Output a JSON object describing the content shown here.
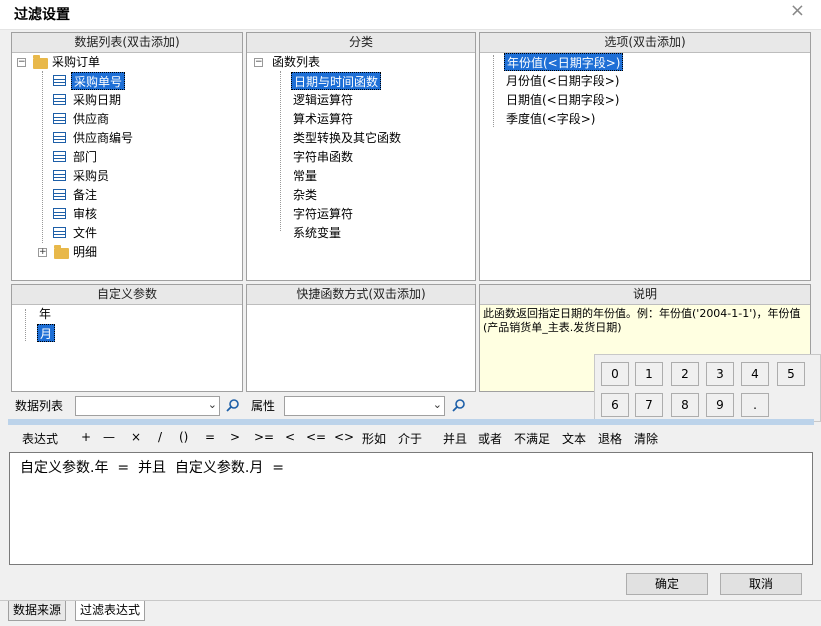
{
  "window": {
    "title": "过滤设置",
    "close_glyph": "×"
  },
  "panels": {
    "data_list": {
      "header": "数据列表(双击添加)",
      "root": "采购订单",
      "fields": [
        "采购单号",
        "采购日期",
        "供应商",
        "供应商编号",
        "部门",
        "采购员",
        "备注",
        "审核",
        "文件"
      ],
      "subfolder": "明细"
    },
    "category": {
      "header": "分类",
      "root": "函数列表",
      "items": [
        "日期与时间函数",
        "逻辑运算符",
        "算术运算符",
        "类型转换及其它函数",
        "字符串函数",
        "常量",
        "杂类",
        "字符运算符",
        "系统变量"
      ]
    },
    "options": {
      "header": "选项(双击添加)",
      "items": [
        "年份值(<日期字段>)",
        "月份值(<日期字段>)",
        "日期值(<日期字段>)",
        "季度值(<字段>)"
      ]
    },
    "custom_params": {
      "header": "自定义参数",
      "items": [
        "年",
        "月"
      ]
    },
    "shortcut": {
      "header": "快捷函数方式(双击添加)"
    },
    "description": {
      "header": "说明",
      "text": "此函数返回指定日期的年份值。例：年份值('2004-1-1')，年份值(产品销货单_主表.发货日期)"
    }
  },
  "filters": {
    "data_list_label": "数据列表",
    "data_list_value": "",
    "property_label": "属性",
    "property_value": ""
  },
  "numpad": [
    "0",
    "1",
    "2",
    "3",
    "4",
    "5",
    "6",
    "7",
    "8",
    "9",
    "."
  ],
  "operators": [
    "表达式",
    "+",
    "—",
    "×",
    "/",
    "()",
    "=",
    ">",
    ">=",
    "<",
    "<=",
    "<>",
    "形如",
    "介于",
    "并且",
    "或者",
    "不满足",
    "文本",
    "退格",
    "清除"
  ],
  "expression": "自定义参数.年  =  并且  自定义参数.月  =",
  "buttons": {
    "ok": "确定",
    "cancel": "取消"
  },
  "tabs": [
    "数据来源",
    "过滤表达式"
  ],
  "colors": {
    "selection": "#1e6fd6",
    "description_bg": "#ffffe1",
    "accent": "#1d5fa8"
  }
}
